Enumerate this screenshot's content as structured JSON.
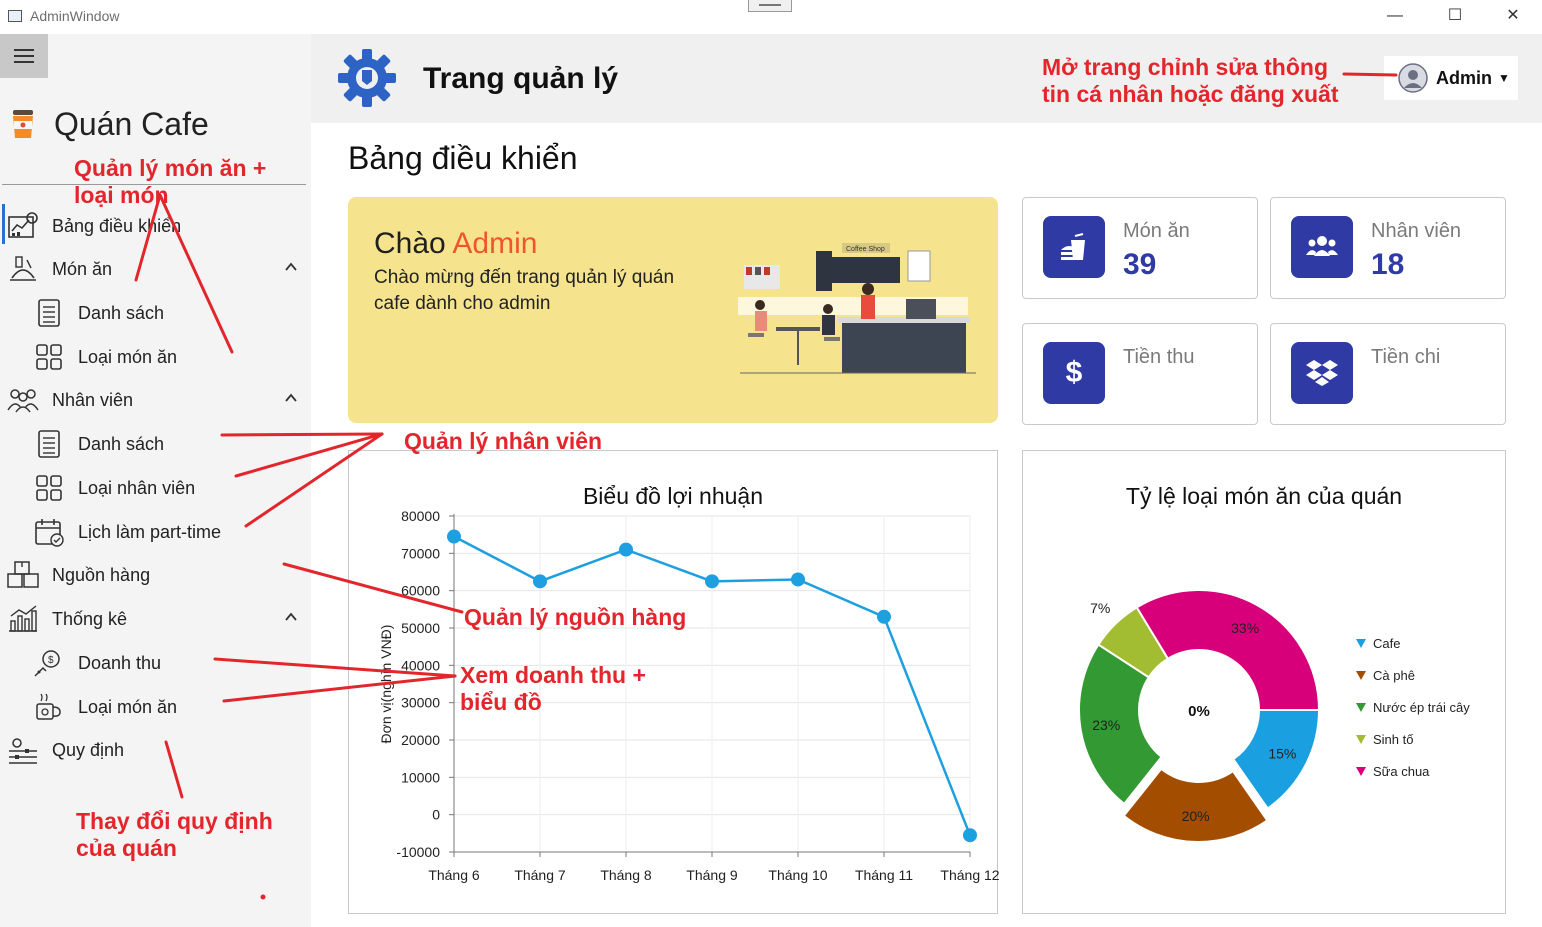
{
  "window": {
    "title": "AdminWindow",
    "minimize": "—",
    "maximize": "☐",
    "close": "✕"
  },
  "sidebar": {
    "brand": "Quán Cafe",
    "items": [
      {
        "label": "Bảng điều khiển",
        "icon": "dashboard-icon",
        "level": 0
      },
      {
        "label": "Món ăn",
        "icon": "food-icon",
        "level": 0,
        "expanded": true
      },
      {
        "label": "Danh sách",
        "icon": "list-icon",
        "level": 1
      },
      {
        "label": "Loại món ăn",
        "icon": "grid-icon",
        "level": 1
      },
      {
        "label": "Nhân viên",
        "icon": "staff-icon",
        "level": 0,
        "expanded": true
      },
      {
        "label": "Danh sách",
        "icon": "list-icon",
        "level": 1
      },
      {
        "label": "Loại nhân viên",
        "icon": "grid-icon",
        "level": 1
      },
      {
        "label": "Lịch làm part-time",
        "icon": "calendar-icon",
        "level": 1
      },
      {
        "label": "Nguồn hàng",
        "icon": "boxes-icon",
        "level": 0
      },
      {
        "label": "Thống kê",
        "icon": "stats-icon",
        "level": 0,
        "expanded": true
      },
      {
        "label": "Doanh thu",
        "icon": "revenue-icon",
        "level": 1
      },
      {
        "label": "Loại món ăn",
        "icon": "food-type-icon",
        "level": 1
      },
      {
        "label": "Quy định",
        "icon": "settings-sliders-icon",
        "level": 0
      }
    ]
  },
  "header": {
    "title": "Trang quản lý",
    "user_button": "Admin"
  },
  "main": {
    "page_title": "Bảng điều khiển",
    "welcome": {
      "greeting": "Chào",
      "name": "Admin",
      "message": "Chào mừng đến trang quản lý quán cafe dành cho admin",
      "sign_text": "Coffee Shop"
    },
    "stats": [
      {
        "label": "Món ăn",
        "value": "39",
        "icon": "burger-drink-icon"
      },
      {
        "label": "Nhân viên",
        "value": "18",
        "icon": "users-icon"
      },
      {
        "label": "Tiền thu",
        "value": "",
        "icon": "dollar-icon"
      },
      {
        "label": "Tiền chi",
        "value": "",
        "icon": "dropbox-icon"
      }
    ]
  },
  "chart_data": [
    {
      "type": "line",
      "title": "Biểu đồ lợi nhuận",
      "ylabel": "Đơn vị(nghìn VNĐ)",
      "categories": [
        "Tháng 6",
        "Tháng 7",
        "Tháng 8",
        "Tháng 9",
        "Tháng 10",
        "Tháng 11",
        "Tháng 12"
      ],
      "values": [
        74500,
        62500,
        71000,
        62500,
        63000,
        53000,
        -5500
      ],
      "ylim": [
        -10000,
        80000
      ],
      "yticks": [
        80000,
        70000,
        60000,
        50000,
        40000,
        30000,
        20000,
        10000,
        0,
        -10000
      ],
      "grid": true,
      "color": "#1e9fe0"
    },
    {
      "type": "pie",
      "title": "Tỷ lệ loại món ăn của quán",
      "center_label": "0%",
      "legend_position": "right",
      "slices": [
        {
          "name": "Cafe",
          "value": 15,
          "label": "15%",
          "color": "#1a9fe0"
        },
        {
          "name": "Cà phê",
          "value": 20,
          "label": "20%",
          "color": "#a24d00"
        },
        {
          "name": "Nước ép trái cây",
          "value": 23,
          "label": "23%",
          "color": "#339933"
        },
        {
          "name": "Sinh tố",
          "value": 7,
          "label": "7%",
          "color": "#a3bd33"
        },
        {
          "name": "Sữa chua",
          "value": 33,
          "label": "33%",
          "color": "#d8007a"
        }
      ]
    }
  ],
  "annotations": {
    "food": "Quản lý món ăn +\nloại món",
    "staff": "Quản lý nhân viên",
    "supply": "Quản lý nguồn hàng",
    "revenue": "Xem doanh thu +\nbiểu đồ",
    "rules": "Thay đổi quy định\ncủa quán",
    "profile": "Mở trang chỉnh sửa thông\ntin cá nhân hoặc đăng xuất",
    "color": "#e3262c"
  }
}
